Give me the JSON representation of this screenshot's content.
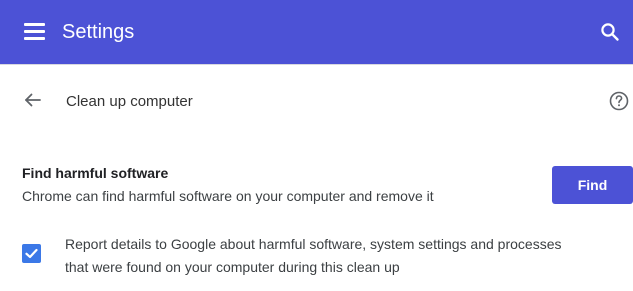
{
  "header": {
    "title": "Settings",
    "menu_icon": "hamburger-menu-icon",
    "search_icon": "search-icon",
    "background_color": "#4c52d6"
  },
  "subpage": {
    "title": "Clean up computer",
    "back_icon": "arrow-back-icon",
    "help_icon": "help-circle-icon"
  },
  "find_section": {
    "heading": "Find harmful software",
    "description": "Chrome can find harmful software on your computer and remove it",
    "button_label": "Find",
    "button_color": "#4c52d6"
  },
  "report_option": {
    "checked": true,
    "label": "Report details to Google about harmful software, system settings and processes\nthat were found on your computer during this clean up",
    "checkbox_color": "#3b78e7"
  }
}
